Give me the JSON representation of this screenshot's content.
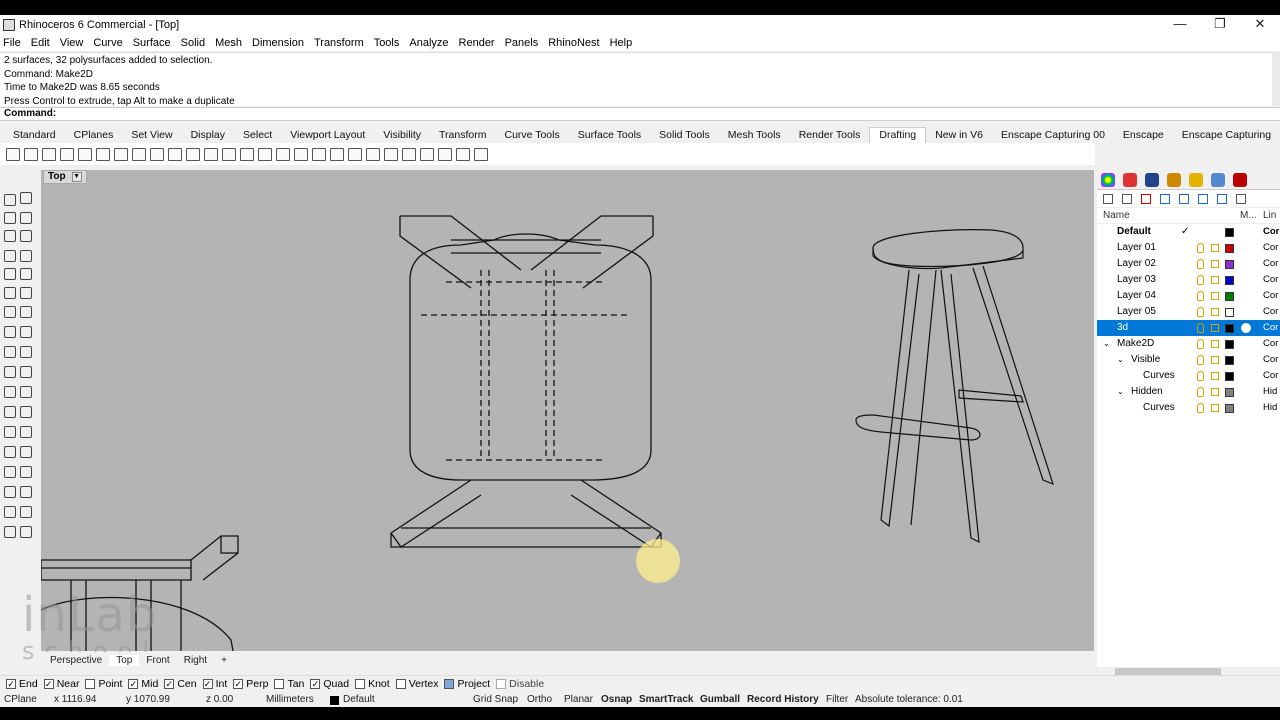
{
  "window": {
    "title": "Rhinoceros 6 Commercial - [Top]",
    "minimize": "—",
    "restore": "❐",
    "close": "✕"
  },
  "menu": [
    "File",
    "Edit",
    "View",
    "Curve",
    "Surface",
    "Solid",
    "Mesh",
    "Dimension",
    "Transform",
    "Tools",
    "Analyze",
    "Render",
    "Panels",
    "RhinoNest",
    "Help"
  ],
  "history": [
    "2 surfaces, 32 polysurfaces added to selection.",
    "Command: Make2D",
    "Time to Make2D was 8.65 seconds",
    "Press Control to extrude, tap Alt to make a duplicate"
  ],
  "command": {
    "label": "Command:"
  },
  "toolbar_tabs": [
    "Standard",
    "CPlanes",
    "Set View",
    "Display",
    "Select",
    "Viewport Layout",
    "Visibility",
    "Transform",
    "Curve Tools",
    "Surface Tools",
    "Solid Tools",
    "Mesh Tools",
    "Render Tools",
    "Drafting",
    "New in V6",
    "Enscape Capturing 00",
    "Enscape",
    "Enscape Capturing"
  ],
  "active_toolbar_tab": "Drafting",
  "viewport": {
    "name": "Top",
    "dropdown": "▼"
  },
  "view_tabs": [
    "Perspective",
    "Top",
    "Front",
    "Right"
  ],
  "view_tab_add": "+",
  "watermark": {
    "line1": "inLab",
    "line2": "school"
  },
  "osnaps": [
    {
      "label": "End",
      "checked": true
    },
    {
      "label": "Near",
      "checked": true
    },
    {
      "label": "Point",
      "checked": false
    },
    {
      "label": "Mid",
      "checked": true
    },
    {
      "label": "Cen",
      "checked": true
    },
    {
      "label": "Int",
      "checked": true
    },
    {
      "label": "Perp",
      "checked": true
    },
    {
      "label": "Tan",
      "checked": false
    },
    {
      "label": "Quad",
      "checked": true
    },
    {
      "label": "Knot",
      "checked": false
    },
    {
      "label": "Vertex",
      "checked": false
    },
    {
      "label": "Project",
      "checked": true,
      "style": "filled"
    },
    {
      "label": "Disable",
      "checked": false,
      "style": "disabled"
    }
  ],
  "status": {
    "cplane": "CPlane",
    "x": "x 1116.94",
    "y": "y 1070.99",
    "z": "z 0.00",
    "units": "Millimeters",
    "layer": "Default",
    "grid_snap": "Grid Snap",
    "ortho": "Ortho",
    "planar": "Planar",
    "osnap": "Osnap",
    "smarttrack": "SmartTrack",
    "gumball": "Gumball",
    "record_history": "Record History",
    "filter": "Filter",
    "tolerance": "Absolute tolerance: 0.01"
  },
  "layers_panel": {
    "col_name": "Name",
    "col_material": "M...",
    "col_linetype": "Lin",
    "rows": [
      {
        "name": "Default",
        "color": "#000000",
        "current": true,
        "bold": true,
        "linetype": "Cor",
        "indent": 0
      },
      {
        "name": "Layer 01",
        "color": "#cc0000",
        "linetype": "Cor",
        "indent": 0
      },
      {
        "name": "Layer 02",
        "color": "#8e2fd0",
        "linetype": "Cor",
        "indent": 0
      },
      {
        "name": "Layer 03",
        "color": "#0000cc",
        "linetype": "Cor",
        "indent": 0
      },
      {
        "name": "Layer 04",
        "color": "#008000",
        "linetype": "Cor",
        "indent": 0
      },
      {
        "name": "Layer 05",
        "color": "#ffffff",
        "linetype": "Cor",
        "indent": 0
      },
      {
        "name": "3d",
        "color": "#000000",
        "linetype": "Cor",
        "indent": 0,
        "selected": true
      },
      {
        "name": "Make2D",
        "color": "#000000",
        "linetype": "Cor",
        "indent": 0,
        "expand": "⌄"
      },
      {
        "name": "Visible",
        "color": "#000000",
        "linetype": "Cor",
        "indent": 1,
        "expand": "⌄"
      },
      {
        "name": "Curves",
        "color": "#000000",
        "linetype": "Cor",
        "indent": 2
      },
      {
        "name": "Hidden",
        "color": "#808080",
        "linetype": "Hid",
        "indent": 1,
        "expand": "⌄"
      },
      {
        "name": "Curves",
        "color": "#808080",
        "linetype": "Hid",
        "indent": 2
      }
    ],
    "current_mark": "✓"
  },
  "colors": {
    "viewport_bg": "#b4b4b4",
    "selection": "#0078d7"
  }
}
